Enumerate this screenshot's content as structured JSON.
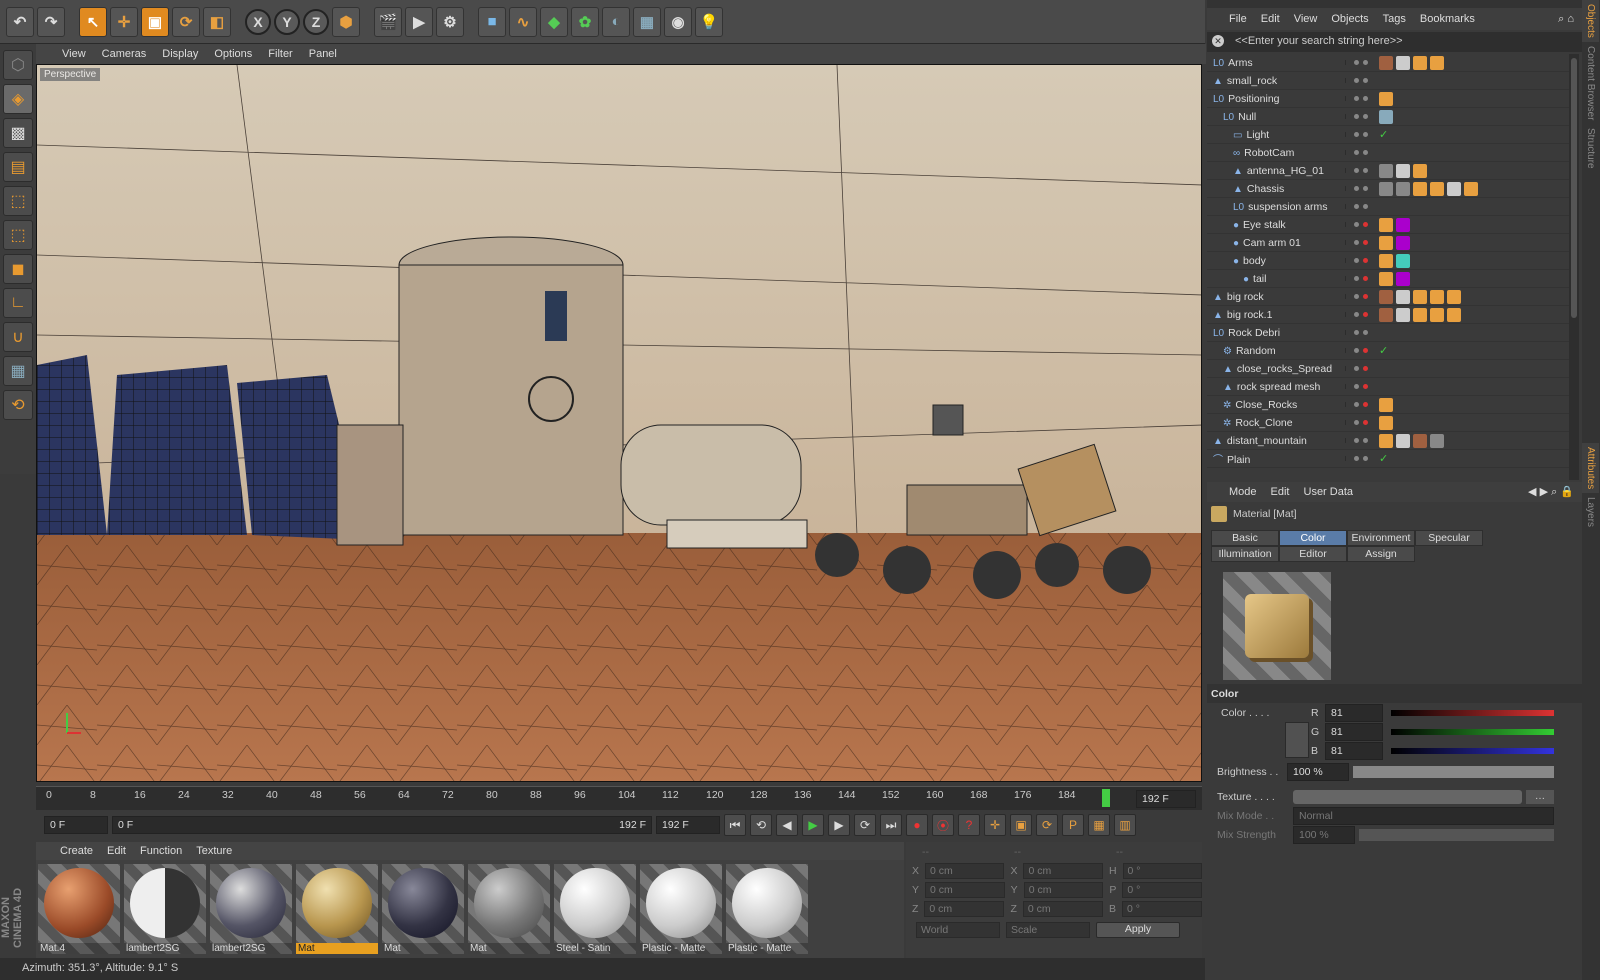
{
  "app_title": "CINEMA 4D",
  "viewport_menu": [
    "View",
    "Cameras",
    "Display",
    "Options",
    "Filter",
    "Panel"
  ],
  "viewport_label": "Perspective",
  "timeline": {
    "ticks": [
      "0",
      "8",
      "16",
      "24",
      "32",
      "40",
      "48",
      "56",
      "64",
      "72",
      "80",
      "88",
      "96",
      "104",
      "112",
      "120",
      "128",
      "136",
      "144",
      "152",
      "160",
      "168",
      "176",
      "184"
    ],
    "end_frame": "192 F",
    "current_frame": "0 F",
    "range_start": "0 F",
    "range_end": "192 F",
    "range_end_field": "192 F",
    "playhead_fraction": 0.96
  },
  "material_manager": {
    "menu": [
      "Create",
      "Edit",
      "Function",
      "Texture"
    ],
    "materials": [
      {
        "name": "Mat.4",
        "style": "mars"
      },
      {
        "name": "lambert2SG",
        "style": "half"
      },
      {
        "name": "lambert2SG",
        "style": "chrome"
      },
      {
        "name": "Mat",
        "style": "gold",
        "selected": true
      },
      {
        "name": "Mat",
        "style": "dark"
      },
      {
        "name": "Mat",
        "style": "grey"
      },
      {
        "name": "Steel - Satin",
        "style": "white"
      },
      {
        "name": "Plastic - Matte",
        "style": "white"
      },
      {
        "name": "Plastic - Matte",
        "style": "white"
      }
    ]
  },
  "coordinates": {
    "header": [
      "--",
      "--",
      "--"
    ],
    "rows": [
      {
        "a": "X",
        "av": "0 cm",
        "b": "X",
        "bv": "0 cm",
        "c": "H",
        "cv": "0 °"
      },
      {
        "a": "Y",
        "av": "0 cm",
        "b": "Y",
        "bv": "0 cm",
        "c": "P",
        "cv": "0 °"
      },
      {
        "a": "Z",
        "av": "0 cm",
        "b": "Z",
        "bv": "0 cm",
        "c": "B",
        "cv": "0 °"
      }
    ],
    "mode": "World",
    "scale": "Scale",
    "apply": "Apply"
  },
  "status": "Azimuth: 351.3°, Altitude: 9.1°  S",
  "branding": "MAXON CINEMA 4D",
  "objects_menu": [
    "File",
    "Edit",
    "View",
    "Objects",
    "Tags",
    "Bookmarks"
  ],
  "search_placeholder": "<<Enter your search string here>>",
  "objects": [
    {
      "name": "Arms",
      "indent": 0,
      "icon": "null"
    },
    {
      "name": "small_rock",
      "indent": 0,
      "icon": "mesh"
    },
    {
      "name": "Positioning",
      "indent": 0,
      "icon": "null"
    },
    {
      "name": "Null",
      "indent": 1,
      "icon": "null"
    },
    {
      "name": "Light",
      "indent": 2,
      "icon": "light"
    },
    {
      "name": "RobotCam",
      "indent": 2,
      "icon": "camera"
    },
    {
      "name": "antenna_HG_01",
      "indent": 2,
      "icon": "mesh"
    },
    {
      "name": "Chassis",
      "indent": 2,
      "icon": "mesh"
    },
    {
      "name": "suspension arms",
      "indent": 2,
      "icon": "null"
    },
    {
      "name": "Eye stalk",
      "indent": 2,
      "icon": "sphere"
    },
    {
      "name": "Cam arm 01",
      "indent": 2,
      "icon": "sphere"
    },
    {
      "name": "body",
      "indent": 2,
      "icon": "sphere"
    },
    {
      "name": "tail",
      "indent": 3,
      "icon": "sphere"
    },
    {
      "name": "big rock",
      "indent": 0,
      "icon": "mesh"
    },
    {
      "name": "big rock.1",
      "indent": 0,
      "icon": "mesh"
    },
    {
      "name": "Rock Debri",
      "indent": 0,
      "icon": "null"
    },
    {
      "name": "Random",
      "indent": 1,
      "icon": "effector"
    },
    {
      "name": "close_rocks_Spread",
      "indent": 1,
      "icon": "mesh"
    },
    {
      "name": "rock spread mesh",
      "indent": 1,
      "icon": "mesh"
    },
    {
      "name": "Close_Rocks",
      "indent": 1,
      "icon": "cloner"
    },
    {
      "name": "Rock_Clone",
      "indent": 1,
      "icon": "cloner"
    },
    {
      "name": "distant_mountain",
      "indent": 0,
      "icon": "mesh"
    },
    {
      "name": "Plain",
      "indent": 0,
      "icon": "plane"
    }
  ],
  "attributes": {
    "menu": [
      "Mode",
      "Edit",
      "User Data"
    ],
    "title": "Material [Mat]",
    "tabs": [
      "Basic",
      "Color",
      "Environment",
      "Specular",
      "Illumination",
      "Editor",
      "Assign"
    ],
    "active_tab": "Color",
    "section": "Color",
    "color_label": "Color . . . .",
    "r": "81",
    "g": "81",
    "b": "81",
    "r_label": "R",
    "g_label": "G",
    "b_label": "B",
    "brightness_label": "Brightness . .",
    "brightness": "100 %",
    "texture_label": "Texture . . . .",
    "mix_mode_label": "Mix Mode . .",
    "mix_mode": "Normal",
    "mix_strength_label": "Mix Strength",
    "mix_strength": "100 %"
  },
  "side_tabs": [
    "Objects",
    "Content Browser",
    "Structure",
    "Attributes",
    "Layers"
  ]
}
